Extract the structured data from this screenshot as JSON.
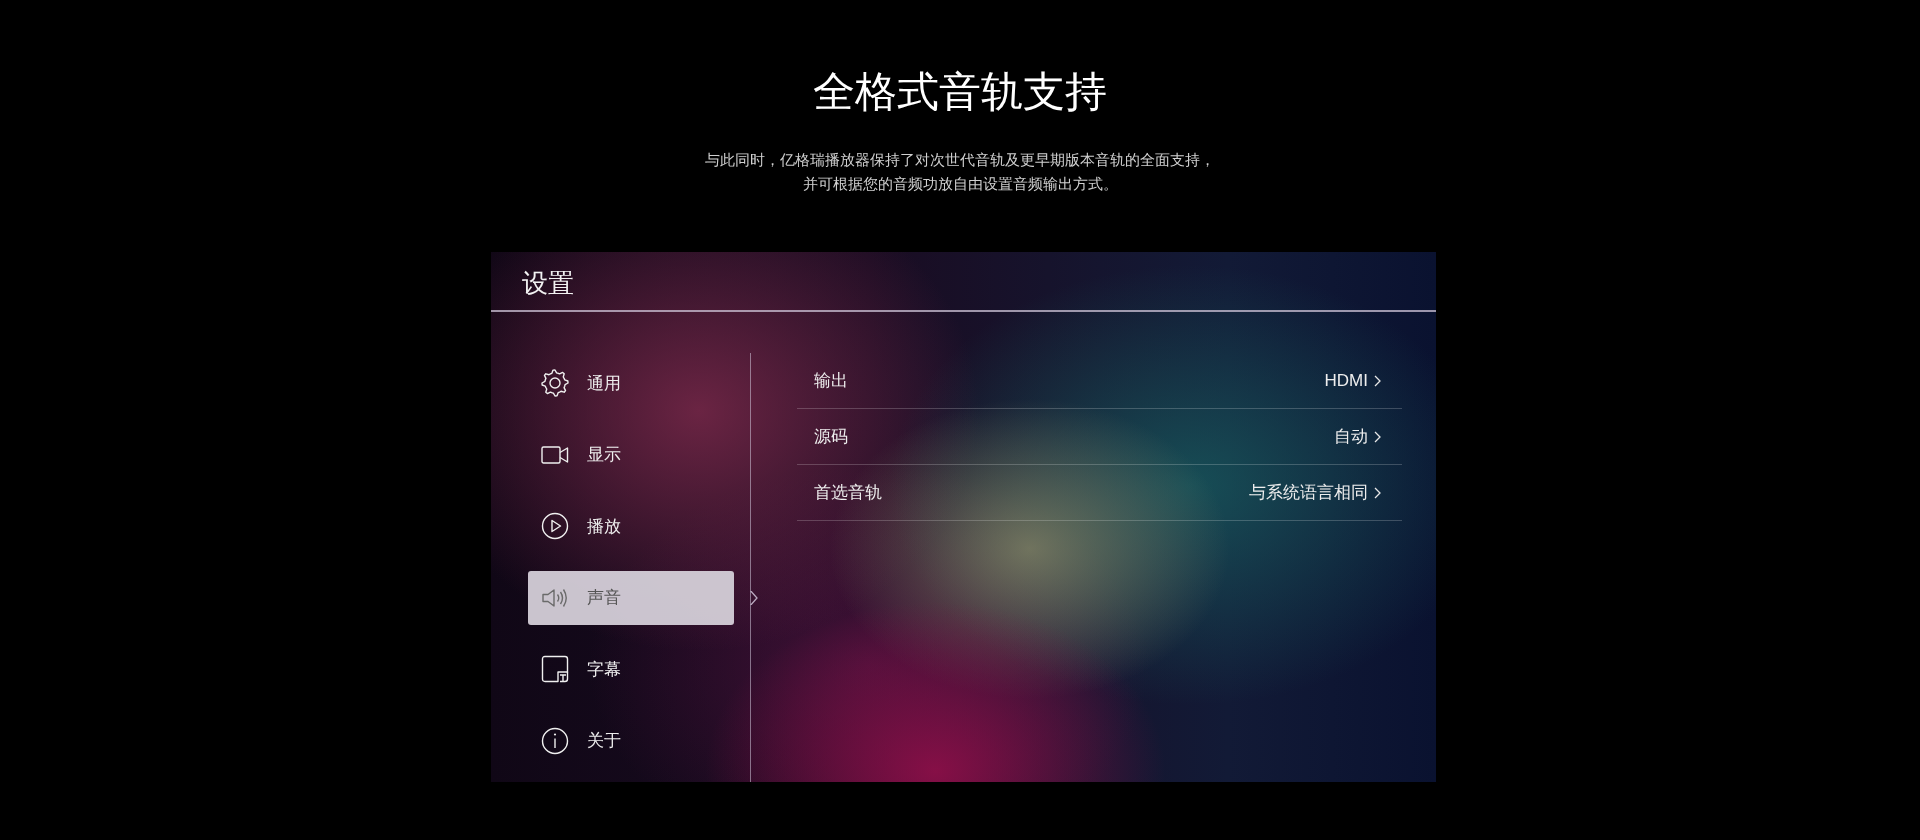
{
  "headline": "全格式音轨支持",
  "description": [
    "与此同时，亿格瑞播放器保持了对次世代音轨及更早期版本音轨的全面支持，",
    "并可根据您的音频功放自由设置音频输出方式。"
  ],
  "settings": {
    "title": "设置",
    "sidebar": {
      "items": [
        {
          "label": "通用",
          "selected": false
        },
        {
          "label": "显示",
          "selected": false
        },
        {
          "label": "播放",
          "selected": false
        },
        {
          "label": "声音",
          "selected": true
        },
        {
          "label": "字幕",
          "selected": false
        },
        {
          "label": "关于",
          "selected": false
        }
      ]
    },
    "options": [
      {
        "label": "输出",
        "value": "HDMI"
      },
      {
        "label": "源码",
        "value": "自动"
      },
      {
        "label": "首选音轨",
        "value": "与系统语言相同"
      }
    ]
  }
}
